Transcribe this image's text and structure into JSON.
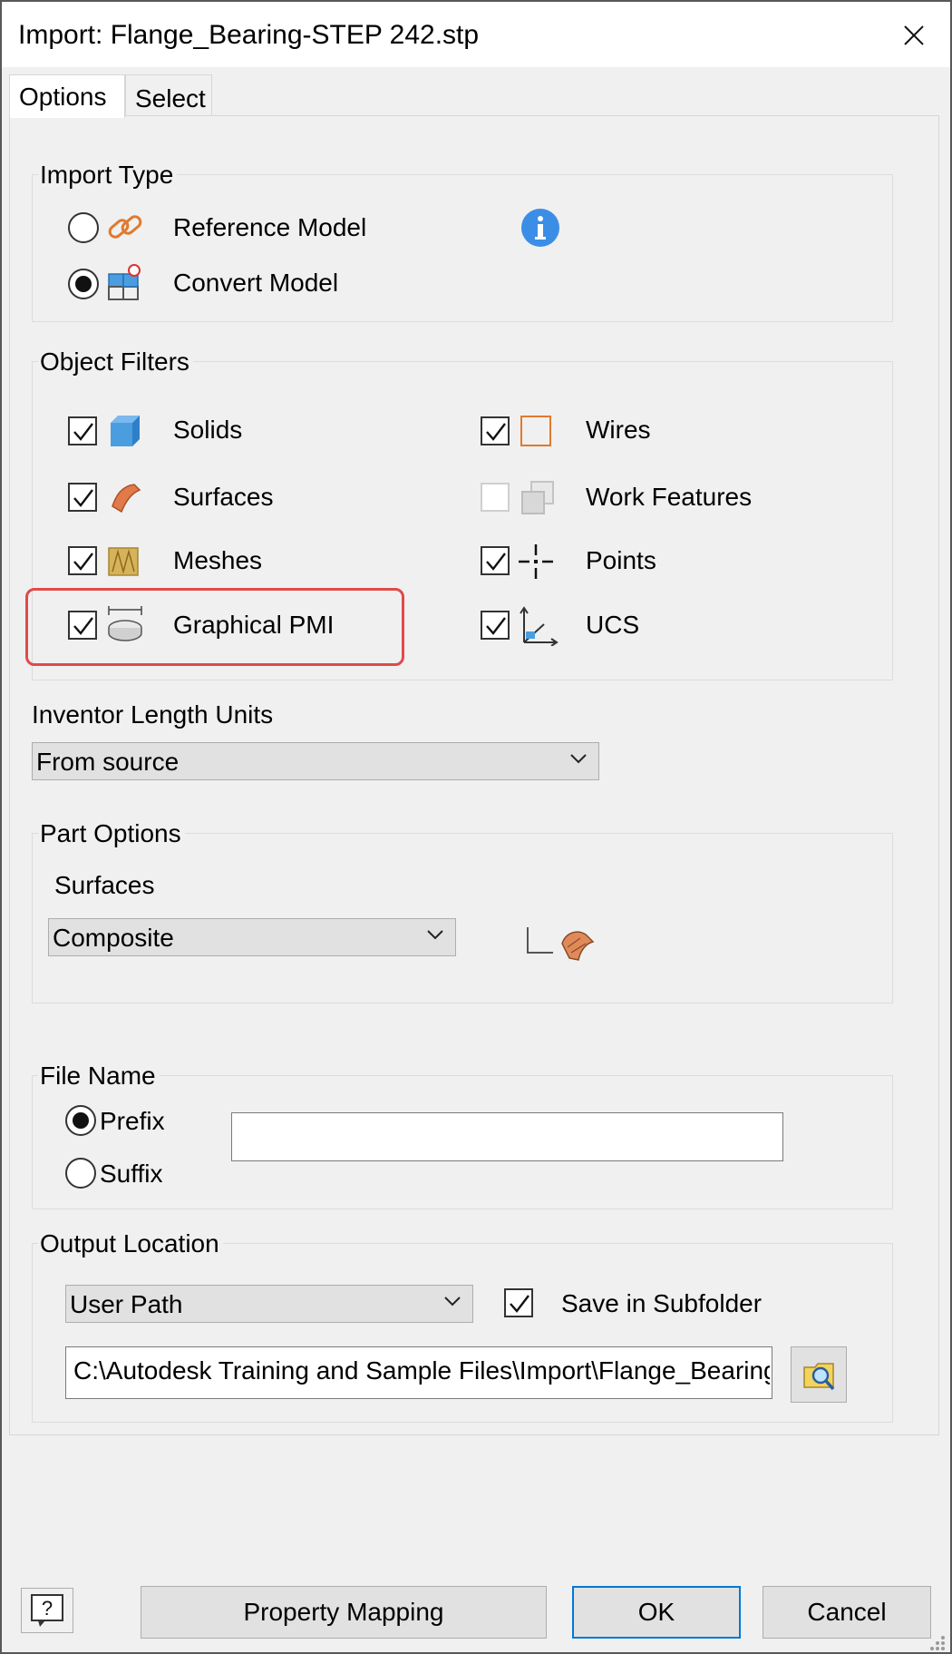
{
  "window": {
    "title": "Import:  Flange_Bearing-STEP 242.stp"
  },
  "tabs": [
    {
      "label": "Options",
      "active": true
    },
    {
      "label": "Select",
      "active": false
    }
  ],
  "import_type": {
    "label": "Import Type",
    "options": [
      {
        "label": "Reference Model",
        "selected": false,
        "icon": "link-icon"
      },
      {
        "label": "Convert Model",
        "selected": true,
        "icon": "convert-model-icon"
      }
    ],
    "info_icon": "info-icon"
  },
  "object_filters": {
    "label": "Object Filters",
    "items": [
      {
        "label": "Solids",
        "checked": true,
        "enabled": true,
        "icon": "solid-cube-icon"
      },
      {
        "label": "Wires",
        "checked": true,
        "enabled": true,
        "icon": "wire-icon"
      },
      {
        "label": "Surfaces",
        "checked": true,
        "enabled": true,
        "icon": "surface-icon"
      },
      {
        "label": "Work Features",
        "checked": false,
        "enabled": false,
        "icon": "work-features-icon"
      },
      {
        "label": "Meshes",
        "checked": true,
        "enabled": true,
        "icon": "mesh-icon"
      },
      {
        "label": "Points",
        "checked": true,
        "enabled": true,
        "icon": "point-icon"
      },
      {
        "label": "Graphical PMI",
        "checked": true,
        "enabled": true,
        "icon": "pmi-icon"
      },
      {
        "label": "UCS",
        "checked": true,
        "enabled": true,
        "icon": "ucs-icon"
      }
    ]
  },
  "length_units": {
    "label": "Inventor Length Units",
    "value": "From source"
  },
  "part_options": {
    "label": "Part Options",
    "surfaces_label": "Surfaces",
    "surfaces_value": "Composite",
    "icon": "composite-surface-icon"
  },
  "file_name": {
    "label": "File Name",
    "options": [
      {
        "label": "Prefix",
        "selected": true
      },
      {
        "label": "Suffix",
        "selected": false
      }
    ],
    "value": ""
  },
  "output_location": {
    "label": "Output Location",
    "mode": "User Path",
    "save_in_subfolder_label": "Save in Subfolder",
    "save_in_subfolder": true,
    "path": "C:\\Autodesk Training and Sample Files\\Import\\Flange_Bearing-S",
    "browse_icon": "browse-folder-icon"
  },
  "footer": {
    "help_icon": "help-icon",
    "property_mapping_label": "Property Mapping",
    "ok_label": "OK",
    "cancel_label": "Cancel"
  },
  "colors": {
    "accent": "#0078d7",
    "highlight": "#e04a4a",
    "info": "#3b8ee6"
  }
}
